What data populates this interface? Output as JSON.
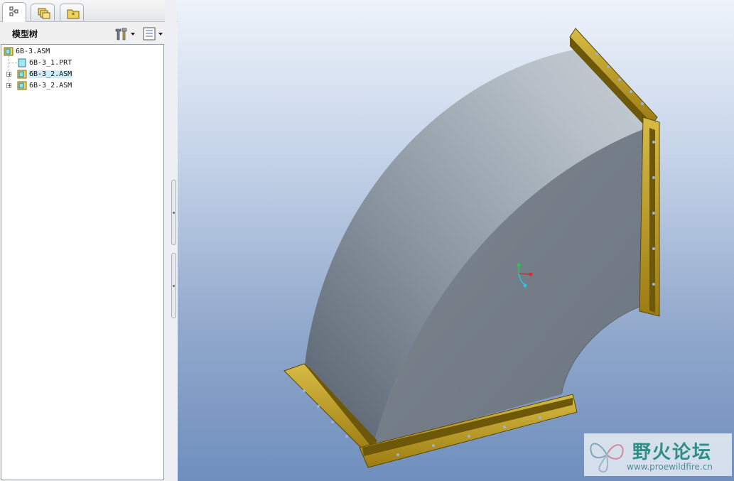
{
  "navigator": {
    "tabs": [
      {
        "icon": "model-tree-icon",
        "active": true
      },
      {
        "icon": "layers-icon",
        "active": false
      },
      {
        "icon": "favorites-folder-icon",
        "active": false
      }
    ],
    "title": "模型树",
    "settings_icon": "tools-icon",
    "show_icon": "tree-columns-icon"
  },
  "tree": {
    "root": "6B-3.ASM",
    "items": [
      {
        "label": "6B-3_1.PRT",
        "type": "part",
        "expandable": false,
        "selected": false
      },
      {
        "label": "6B-3_2.ASM",
        "type": "assembly",
        "expandable": true,
        "selected": true
      },
      {
        "label": "6B-3_2.ASM",
        "type": "assembly",
        "expandable": true,
        "selected": false
      }
    ]
  },
  "viewport": {
    "model": "duct-elbow-with-flanges",
    "colors": {
      "flange": "#b8961c",
      "duct": "#9aa4ae",
      "csys_x": "#e0263a",
      "csys_y": "#22cc44",
      "csys_z": "#22c8e0"
    }
  },
  "watermark": {
    "name": "野火论坛",
    "url": "www.proewildfire.cn"
  }
}
